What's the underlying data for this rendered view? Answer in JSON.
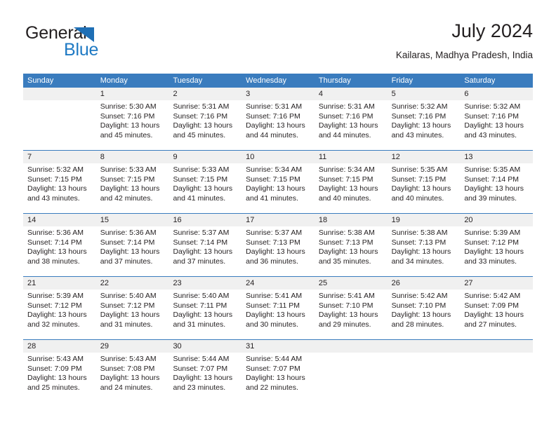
{
  "logo": {
    "word_dark": "General",
    "word_blue": "Blue",
    "triangle_color": "#1f6fb5",
    "blue_color": "#1f7ac4"
  },
  "header": {
    "title": "July 2024",
    "subtitle": "Kailaras, Madhya Pradesh, India"
  },
  "theme": {
    "header_bg": "#3a7cbe",
    "header_text": "#ffffff",
    "date_band_bg": "#f0f0f0",
    "text": "#231f20"
  },
  "weekdays": [
    "Sunday",
    "Monday",
    "Tuesday",
    "Wednesday",
    "Thursday",
    "Friday",
    "Saturday"
  ],
  "weeks": [
    {
      "days": [
        {
          "date": "",
          "lines": [
            "",
            "",
            "",
            ""
          ]
        },
        {
          "date": "1",
          "lines": [
            "Sunrise: 5:30 AM",
            "Sunset: 7:16 PM",
            "Daylight: 13 hours",
            "and 45 minutes."
          ]
        },
        {
          "date": "2",
          "lines": [
            "Sunrise: 5:31 AM",
            "Sunset: 7:16 PM",
            "Daylight: 13 hours",
            "and 45 minutes."
          ]
        },
        {
          "date": "3",
          "lines": [
            "Sunrise: 5:31 AM",
            "Sunset: 7:16 PM",
            "Daylight: 13 hours",
            "and 44 minutes."
          ]
        },
        {
          "date": "4",
          "lines": [
            "Sunrise: 5:31 AM",
            "Sunset: 7:16 PM",
            "Daylight: 13 hours",
            "and 44 minutes."
          ]
        },
        {
          "date": "5",
          "lines": [
            "Sunrise: 5:32 AM",
            "Sunset: 7:16 PM",
            "Daylight: 13 hours",
            "and 43 minutes."
          ]
        },
        {
          "date": "6",
          "lines": [
            "Sunrise: 5:32 AM",
            "Sunset: 7:16 PM",
            "Daylight: 13 hours",
            "and 43 minutes."
          ]
        }
      ]
    },
    {
      "days": [
        {
          "date": "7",
          "lines": [
            "Sunrise: 5:32 AM",
            "Sunset: 7:15 PM",
            "Daylight: 13 hours",
            "and 43 minutes."
          ]
        },
        {
          "date": "8",
          "lines": [
            "Sunrise: 5:33 AM",
            "Sunset: 7:15 PM",
            "Daylight: 13 hours",
            "and 42 minutes."
          ]
        },
        {
          "date": "9",
          "lines": [
            "Sunrise: 5:33 AM",
            "Sunset: 7:15 PM",
            "Daylight: 13 hours",
            "and 41 minutes."
          ]
        },
        {
          "date": "10",
          "lines": [
            "Sunrise: 5:34 AM",
            "Sunset: 7:15 PM",
            "Daylight: 13 hours",
            "and 41 minutes."
          ]
        },
        {
          "date": "11",
          "lines": [
            "Sunrise: 5:34 AM",
            "Sunset: 7:15 PM",
            "Daylight: 13 hours",
            "and 40 minutes."
          ]
        },
        {
          "date": "12",
          "lines": [
            "Sunrise: 5:35 AM",
            "Sunset: 7:15 PM",
            "Daylight: 13 hours",
            "and 40 minutes."
          ]
        },
        {
          "date": "13",
          "lines": [
            "Sunrise: 5:35 AM",
            "Sunset: 7:14 PM",
            "Daylight: 13 hours",
            "and 39 minutes."
          ]
        }
      ]
    },
    {
      "days": [
        {
          "date": "14",
          "lines": [
            "Sunrise: 5:36 AM",
            "Sunset: 7:14 PM",
            "Daylight: 13 hours",
            "and 38 minutes."
          ]
        },
        {
          "date": "15",
          "lines": [
            "Sunrise: 5:36 AM",
            "Sunset: 7:14 PM",
            "Daylight: 13 hours",
            "and 37 minutes."
          ]
        },
        {
          "date": "16",
          "lines": [
            "Sunrise: 5:37 AM",
            "Sunset: 7:14 PM",
            "Daylight: 13 hours",
            "and 37 minutes."
          ]
        },
        {
          "date": "17",
          "lines": [
            "Sunrise: 5:37 AM",
            "Sunset: 7:13 PM",
            "Daylight: 13 hours",
            "and 36 minutes."
          ]
        },
        {
          "date": "18",
          "lines": [
            "Sunrise: 5:38 AM",
            "Sunset: 7:13 PM",
            "Daylight: 13 hours",
            "and 35 minutes."
          ]
        },
        {
          "date": "19",
          "lines": [
            "Sunrise: 5:38 AM",
            "Sunset: 7:13 PM",
            "Daylight: 13 hours",
            "and 34 minutes."
          ]
        },
        {
          "date": "20",
          "lines": [
            "Sunrise: 5:39 AM",
            "Sunset: 7:12 PM",
            "Daylight: 13 hours",
            "and 33 minutes."
          ]
        }
      ]
    },
    {
      "days": [
        {
          "date": "21",
          "lines": [
            "Sunrise: 5:39 AM",
            "Sunset: 7:12 PM",
            "Daylight: 13 hours",
            "and 32 minutes."
          ]
        },
        {
          "date": "22",
          "lines": [
            "Sunrise: 5:40 AM",
            "Sunset: 7:12 PM",
            "Daylight: 13 hours",
            "and 31 minutes."
          ]
        },
        {
          "date": "23",
          "lines": [
            "Sunrise: 5:40 AM",
            "Sunset: 7:11 PM",
            "Daylight: 13 hours",
            "and 31 minutes."
          ]
        },
        {
          "date": "24",
          "lines": [
            "Sunrise: 5:41 AM",
            "Sunset: 7:11 PM",
            "Daylight: 13 hours",
            "and 30 minutes."
          ]
        },
        {
          "date": "25",
          "lines": [
            "Sunrise: 5:41 AM",
            "Sunset: 7:10 PM",
            "Daylight: 13 hours",
            "and 29 minutes."
          ]
        },
        {
          "date": "26",
          "lines": [
            "Sunrise: 5:42 AM",
            "Sunset: 7:10 PM",
            "Daylight: 13 hours",
            "and 28 minutes."
          ]
        },
        {
          "date": "27",
          "lines": [
            "Sunrise: 5:42 AM",
            "Sunset: 7:09 PM",
            "Daylight: 13 hours",
            "and 27 minutes."
          ]
        }
      ]
    },
    {
      "days": [
        {
          "date": "28",
          "lines": [
            "Sunrise: 5:43 AM",
            "Sunset: 7:09 PM",
            "Daylight: 13 hours",
            "and 25 minutes."
          ]
        },
        {
          "date": "29",
          "lines": [
            "Sunrise: 5:43 AM",
            "Sunset: 7:08 PM",
            "Daylight: 13 hours",
            "and 24 minutes."
          ]
        },
        {
          "date": "30",
          "lines": [
            "Sunrise: 5:44 AM",
            "Sunset: 7:07 PM",
            "Daylight: 13 hours",
            "and 23 minutes."
          ]
        },
        {
          "date": "31",
          "lines": [
            "Sunrise: 5:44 AM",
            "Sunset: 7:07 PM",
            "Daylight: 13 hours",
            "and 22 minutes."
          ]
        },
        {
          "date": "",
          "lines": [
            "",
            "",
            "",
            ""
          ]
        },
        {
          "date": "",
          "lines": [
            "",
            "",
            "",
            ""
          ]
        },
        {
          "date": "",
          "lines": [
            "",
            "",
            "",
            ""
          ]
        }
      ]
    }
  ]
}
